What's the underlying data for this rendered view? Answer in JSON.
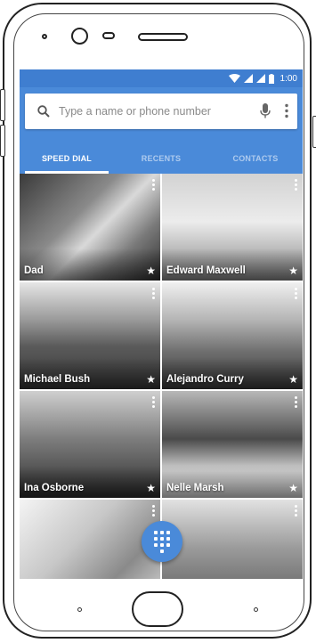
{
  "status_bar": {
    "time": "1:00"
  },
  "search": {
    "placeholder": "Type a name or phone number"
  },
  "tabs": [
    {
      "label": "SPEED DIAL",
      "active": true
    },
    {
      "label": "RECENTS",
      "active": false
    },
    {
      "label": "CONTACTS",
      "active": false
    }
  ],
  "contacts": [
    {
      "name": "Dad"
    },
    {
      "name": "Edward Maxwell"
    },
    {
      "name": "Michael Bush"
    },
    {
      "name": "Alejandro Curry"
    },
    {
      "name": "Ina Osborne"
    },
    {
      "name": "Nelle Marsh"
    },
    {
      "name": ""
    },
    {
      "name": ""
    }
  ],
  "colors": {
    "accent": "#4a8ad9",
    "status_bar": "#3f7ed0"
  },
  "icons": {
    "search": "search-icon",
    "mic": "mic-icon",
    "more": "more-vert-icon",
    "fab": "dialpad-icon",
    "favorite": "star-icon"
  }
}
